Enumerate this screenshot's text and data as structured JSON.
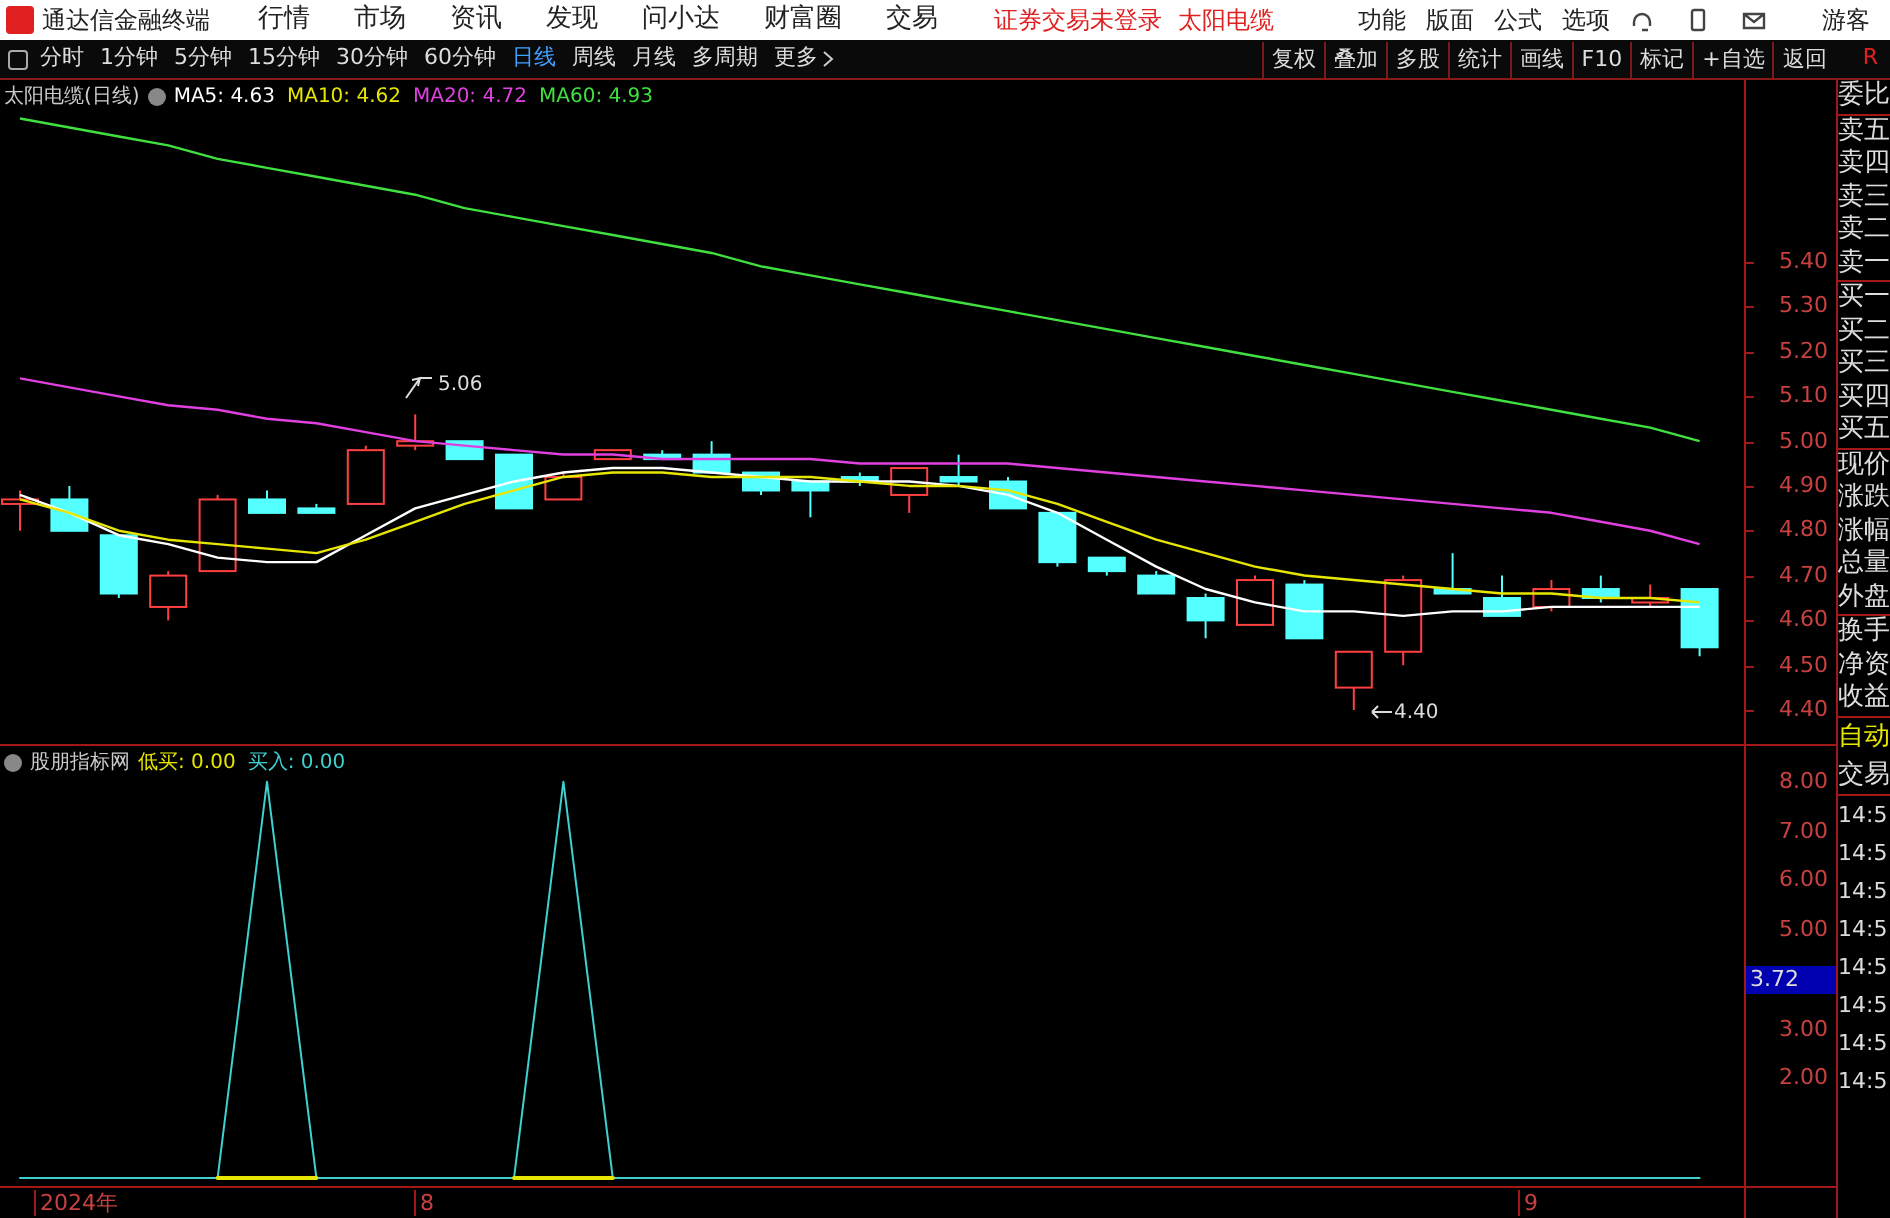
{
  "app": {
    "title": "通达信金融终端"
  },
  "menu": [
    "行情",
    "市场",
    "资讯",
    "发现",
    "问小达",
    "财富圈",
    "交易"
  ],
  "notices": [
    "证券交易未登录",
    "太阳电缆"
  ],
  "right_menu": [
    "功能",
    "版面",
    "公式",
    "选项"
  ],
  "user": "游客",
  "periods": [
    {
      "label": "分时",
      "selected": false
    },
    {
      "label": "1分钟",
      "selected": false
    },
    {
      "label": "5分钟",
      "selected": false
    },
    {
      "label": "15分钟",
      "selected": false
    },
    {
      "label": "30分钟",
      "selected": false
    },
    {
      "label": "60分钟",
      "selected": false
    },
    {
      "label": "日线",
      "selected": true
    },
    {
      "label": "周线",
      "selected": false
    },
    {
      "label": "月线",
      "selected": false
    },
    {
      "label": "多周期",
      "selected": false
    },
    {
      "label": "更多",
      "selected": false
    }
  ],
  "tools": [
    "复权",
    "叠加",
    "多股",
    "统计",
    "画线",
    "F10",
    "标记",
    "+自选",
    "返回"
  ],
  "corner": "R",
  "main_chart": {
    "title": "太阳电缆(日线)",
    "legend_values": [
      ": 4.63",
      ": 4.62",
      ": 4.72",
      ": 4.93"
    ],
    "chart_data": {
      "type": "line",
      "ylim": [
        4.324,
        5.806
      ],
      "yticks": [
        {
          "value": 5.4,
          "label": "5.40"
        },
        {
          "value": 5.3,
          "label": "5.30"
        },
        {
          "value": 5.2,
          "label": "5.20"
        },
        {
          "value": 5.1,
          "label": "5.10"
        },
        {
          "value": 5.0,
          "label": "5.00"
        },
        {
          "value": 4.9,
          "label": "4.90"
        },
        {
          "value": 4.8,
          "label": "4.80"
        },
        {
          "value": 4.7,
          "label": "4.70"
        },
        {
          "value": 4.6,
          "label": "4.60"
        },
        {
          "value": 4.5,
          "label": "4.50"
        },
        {
          "value": 4.4,
          "label": "4.40"
        }
      ],
      "series": [
        {
          "name": "MA5",
          "color": "#ffffff",
          "values": [
            4.88,
            4.84,
            4.79,
            4.77,
            4.74,
            4.73,
            4.73,
            4.79,
            4.85,
            4.88,
            4.91,
            4.93,
            4.94,
            4.94,
            4.93,
            4.92,
            4.91,
            4.91,
            4.91,
            4.9,
            4.88,
            4.84,
            4.78,
            4.72,
            4.67,
            4.64,
            4.62,
            4.62,
            4.61,
            4.62,
            4.62,
            4.63,
            4.63,
            4.63,
            4.63
          ]
        },
        {
          "name": "MA10",
          "color": "#e6e600",
          "values": [
            4.87,
            4.84,
            4.8,
            4.78,
            4.77,
            4.76,
            4.75,
            4.78,
            4.82,
            4.86,
            4.89,
            4.92,
            4.93,
            4.93,
            4.92,
            4.92,
            4.92,
            4.91,
            4.9,
            4.9,
            4.89,
            4.86,
            4.82,
            4.78,
            4.75,
            4.72,
            4.7,
            4.69,
            4.68,
            4.67,
            4.66,
            4.66,
            4.65,
            4.65,
            4.64
          ]
        },
        {
          "name": "MA20",
          "color": "#e040e0",
          "values": [
            5.14,
            5.12,
            5.1,
            5.08,
            5.07,
            5.05,
            5.04,
            5.02,
            5.0,
            4.99,
            4.98,
            4.97,
            4.97,
            4.96,
            4.96,
            4.96,
            4.96,
            4.95,
            4.95,
            4.95,
            4.95,
            4.94,
            4.93,
            4.92,
            4.91,
            4.9,
            4.89,
            4.88,
            4.87,
            4.86,
            4.85,
            4.84,
            4.82,
            4.8,
            4.77
          ]
        },
        {
          "name": "MA60",
          "color": "#40e040",
          "values": [
            5.72,
            5.7,
            5.68,
            5.66,
            5.63,
            5.61,
            5.59,
            5.57,
            5.55,
            5.52,
            5.5,
            5.48,
            5.46,
            5.44,
            5.42,
            5.39,
            5.37,
            5.35,
            5.33,
            5.31,
            5.29,
            5.27,
            5.25,
            5.23,
            5.21,
            5.19,
            5.17,
            5.15,
            5.13,
            5.11,
            5.09,
            5.07,
            5.05,
            5.03,
            5.0
          ]
        }
      ]
    },
    "high_label": "5.06",
    "low_label": "4.40"
  },
  "indicator": {
    "title": "股朋指标网",
    "legend_values": [
      ": 0.00",
      ": 0.00"
    ],
    "chart_data": {
      "type": "line",
      "ylim": [
        -0.12,
        8.72
      ],
      "yticks": [
        {
          "value": 8,
          "label": "8.00"
        },
        {
          "value": 7,
          "label": "7.00"
        },
        {
          "value": 6,
          "label": "6.00"
        },
        {
          "value": 5,
          "label": "5.00"
        },
        {
          "value": 3,
          "label": "3.00"
        },
        {
          "value": 2,
          "label": "2.00"
        }
      ],
      "series": [
        {
          "name": "低买",
          "color": "#e6e600",
          "values": [
            null,
            null,
            null,
            null,
            0,
            0,
            0,
            null,
            null,
            null,
            0,
            0,
            0,
            null,
            null,
            null,
            null,
            null,
            null,
            null,
            null,
            null,
            null,
            null,
            null,
            null,
            null,
            null,
            null,
            null,
            null,
            null,
            null,
            null,
            null
          ]
        },
        {
          "name": "买入",
          "color": "#40d0d0",
          "values": [
            0,
            0,
            0,
            0,
            0,
            8,
            0,
            0,
            0,
            0,
            0,
            8,
            0,
            0,
            0,
            0,
            0,
            0,
            0,
            0,
            0,
            0,
            0,
            0,
            0,
            0,
            0,
            0,
            0,
            0,
            0,
            0,
            0,
            0,
            0
          ]
        }
      ]
    },
    "cursor_value": "3.72"
  },
  "x_axis": [
    "2024年",
    "8",
    "9"
  ],
  "quote_panel": {
    "groups": [
      [
        "委比"
      ],
      [
        "卖五",
        "卖四",
        "卖三",
        "卖二",
        "卖一"
      ],
      [
        "买一",
        "买二",
        "买三",
        "买四",
        "买五"
      ],
      [
        "现价",
        "涨跌",
        "涨幅",
        "总量",
        "外盘"
      ],
      [
        "换手",
        "净资",
        "收益"
      ]
    ],
    "auto": "自动",
    "trade": "交易",
    "times": [
      "14:5",
      "14:5",
      "14:5",
      "14:5",
      "14:5",
      "14:5",
      "14:5",
      "14:5"
    ]
  }
}
